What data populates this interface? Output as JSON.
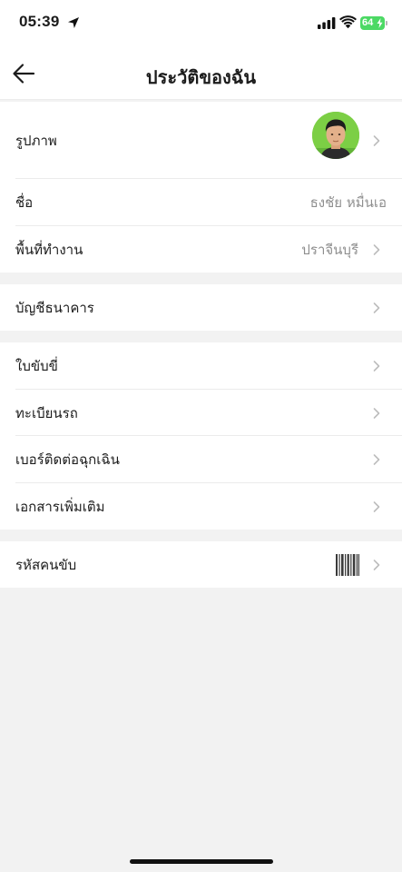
{
  "status_bar": {
    "time": "05:39",
    "battery_level": "64",
    "battery_color": "#4cd964"
  },
  "header": {
    "title": "ประวัติของฉัน",
    "back_icon": "arrow-left-icon"
  },
  "profile_section": {
    "photo_label": "รูปภาพ",
    "name_label": "ชื่อ",
    "name_value": "ธงชัย หมื่นเอ",
    "workplace_label": "พื้นที่ทำงาน",
    "workplace_value": "ปราจีนบุรี"
  },
  "bank_section": {
    "bank_label": "บัญชีธนาคาร"
  },
  "documents_section": {
    "license_label": "ใบขับขี่",
    "vehicle_reg_label": "ทะเบียนรถ",
    "emergency_label": "เบอร์ติดต่อฉุกเฉิน",
    "extra_docs_label": "เอกสารเพิ่มเติม"
  },
  "driver_code_section": {
    "driver_code_label": "รหัสคนขับ",
    "barcode_icon": "barcode-icon"
  },
  "colors": {
    "background": "#f2f2f2",
    "card": "#ffffff",
    "text": "#1c1c1c",
    "secondary_text": "#8e8e8e",
    "chevron": "#bdbdbd"
  }
}
